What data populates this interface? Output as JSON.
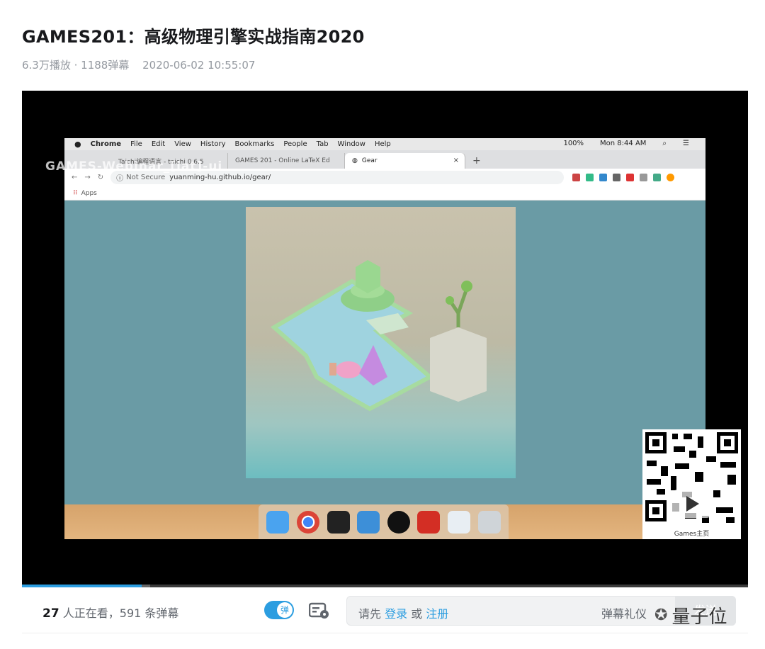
{
  "title": "GAMES201：高级物理引擎实战指南2020",
  "meta": {
    "plays": "6.3万播放 · 1188弹幕",
    "date": "2020-06-02 10:55:07"
  },
  "watermark": "GAMES-Webinar_[iat]-ui",
  "progress": {
    "played_fraction": 0.165,
    "buffered_fraction": 0.012
  },
  "macbar": {
    "apple": "",
    "menus": [
      "Chrome",
      "File",
      "Edit",
      "View",
      "History",
      "Bookmarks",
      "People",
      "Tab",
      "Window",
      "Help"
    ],
    "battery": "100%",
    "clock": "Mon 8:44 AM"
  },
  "browser": {
    "tabs": [
      "Taichi编程语言 - taichi 0.6.5",
      "GAMES 201 - Online LaTeX Ed",
      "Gear"
    ],
    "new_tab": "+",
    "close": "×",
    "not_secure": "Not Secure",
    "url": "yuanming-hu.github.io/gear/",
    "bookmarks": "Apps"
  },
  "qr": {
    "caption": "Games主页"
  },
  "bottom": {
    "viewers_count": "27",
    "viewers_text": " 人正在看，",
    "danmaku_count": "591",
    "danmaku_text": " 条弹幕",
    "toggle_label": "弹",
    "placeholder_prefix": "请先 ",
    "login": "登录",
    "or": " 或 ",
    "register": "注册",
    "etiquette": "弹幕礼仪",
    "send": "发送"
  },
  "brand": "量子位",
  "colors": {
    "accent": "#2b9de0",
    "screen_bg": "#6a9ba5"
  }
}
